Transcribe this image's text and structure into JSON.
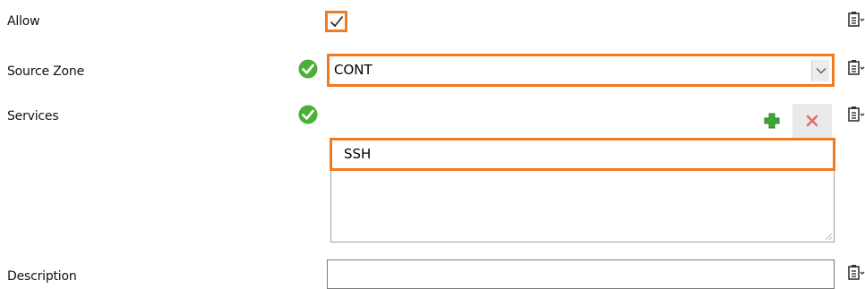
{
  "form": {
    "allow": {
      "label": "Allow",
      "checked": true
    },
    "source_zone": {
      "label": "Source Zone",
      "value": "CONT",
      "valid": true
    },
    "services": {
      "label": "Services",
      "valid": true,
      "items": [
        "SSH"
      ],
      "add_icon": "plus-icon",
      "remove_icon": "x-icon"
    },
    "description": {
      "label": "Description",
      "value": ""
    }
  },
  "icons": {
    "valid": "check-circle-icon",
    "menu": "clipboard-menu-icon"
  },
  "colors": {
    "highlight": "#f07b21",
    "valid_green": "#4caf3a",
    "add_green": "#3ea835",
    "remove_red": "#e36d6d"
  }
}
